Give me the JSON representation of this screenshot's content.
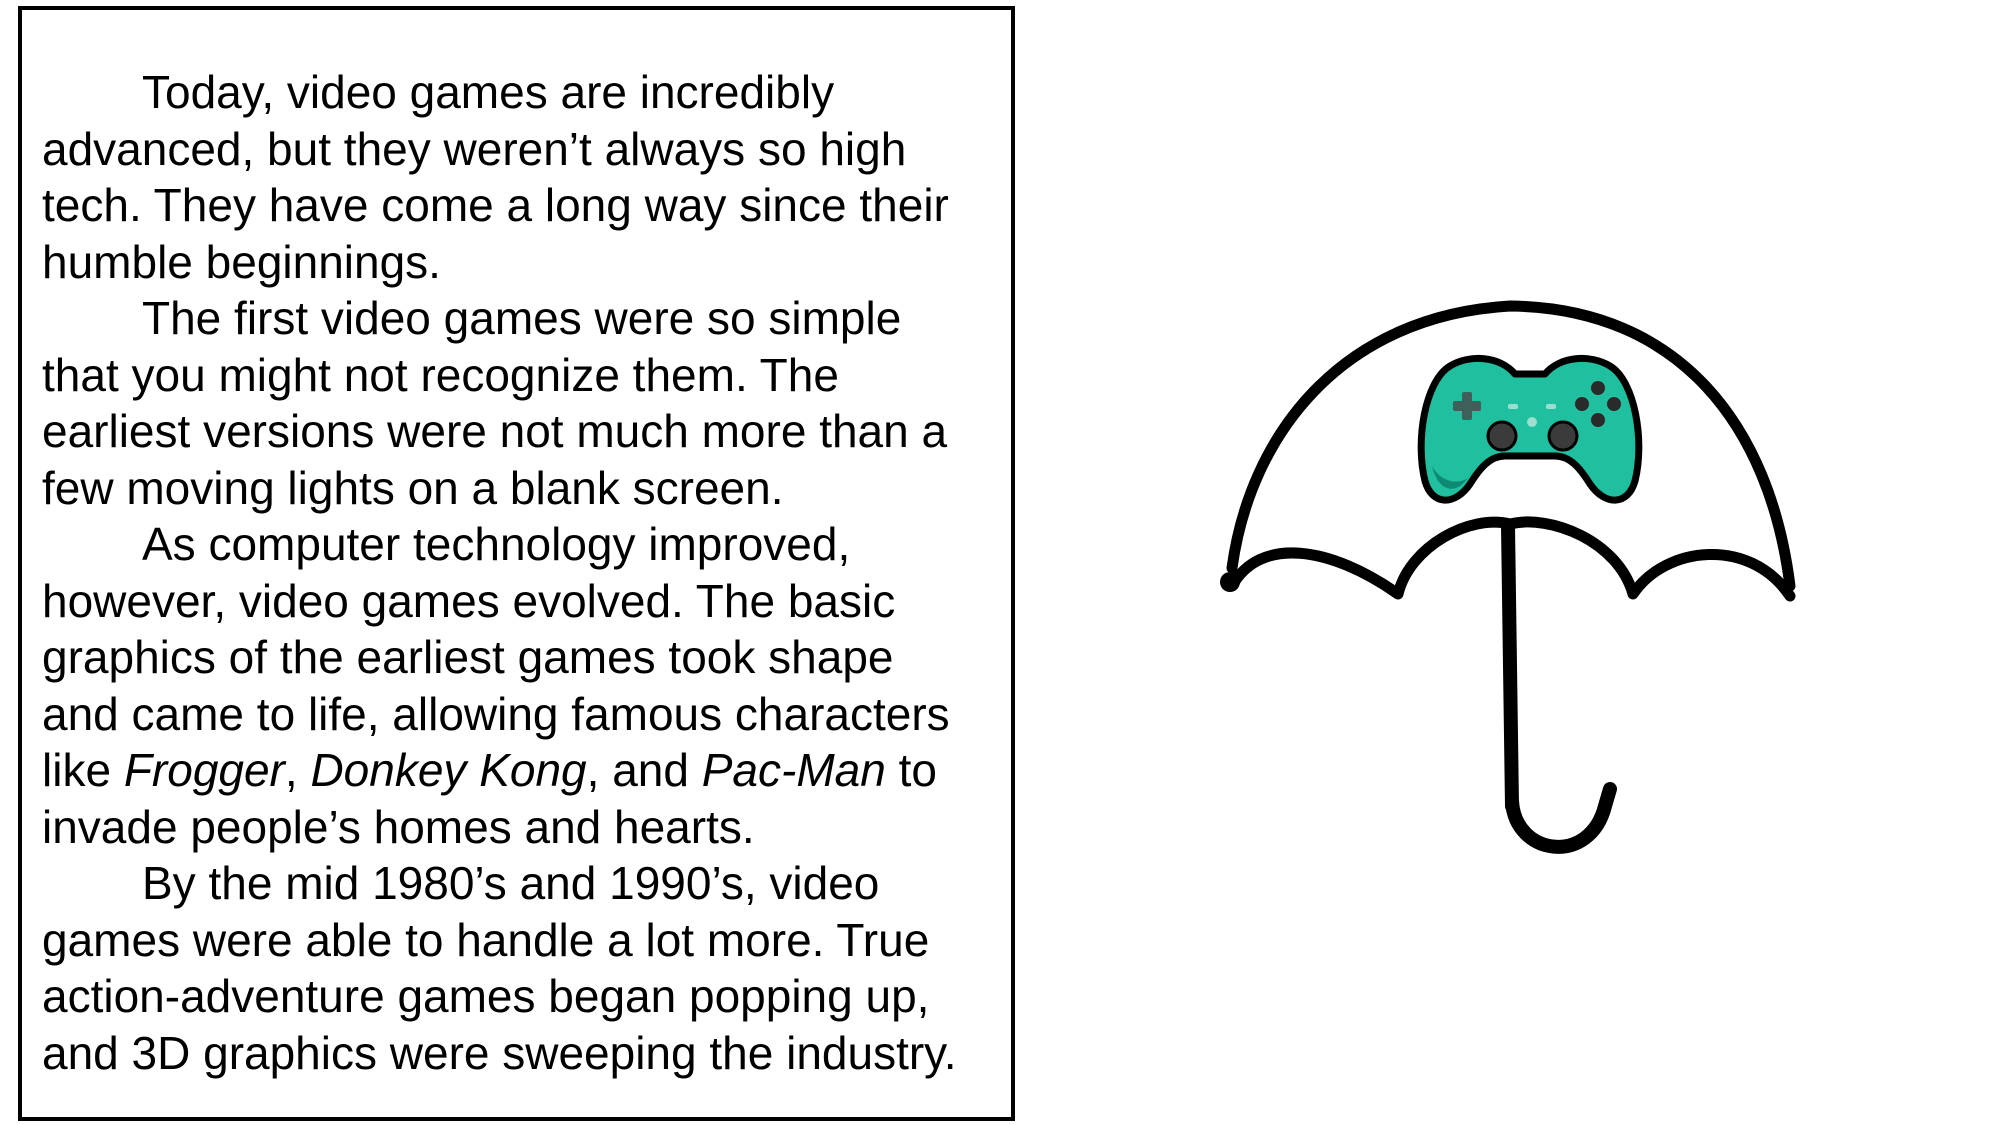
{
  "passage": {
    "paragraphs": [
      {
        "lines": [
          "Today, video games are incredibly",
          "advanced, but they weren’t always so high",
          "tech.  They have come a long way since their",
          "humble beginnings."
        ]
      },
      {
        "lines": [
          "The first video games were so simple",
          "that you might not recognize them.  The",
          "earliest versions were not much more than a",
          "few moving lights on a blank screen."
        ]
      },
      {
        "lines": [
          "As computer technology improved,",
          "however, video games evolved.  The basic",
          "graphics of the earliest games took shape",
          "and came to life, allowing famous characters"
        ],
        "line5": {
          "pre": "like ",
          "frogger": "Frogger",
          "sep1": ", ",
          "donkey_kong": "Donkey Kong",
          "sep2": ", and ",
          "pac_man": "Pac-Man",
          "post": " to"
        },
        "line6": "invade people’s homes and hearts."
      },
      {
        "lines": [
          "By the mid 1980’s and 1990’s, video",
          "games were able to handle a lot more.  True",
          "action-adventure games began popping up,",
          "and 3D graphics were sweeping the industry."
        ]
      }
    ]
  },
  "illustration": {
    "icons": [
      "umbrella-icon",
      "game-controller-icon"
    ],
    "colors": {
      "outline": "#000000",
      "controller_body": "#1fbf9f",
      "controller_shadow": "#0e8a72",
      "background": "#ffffff"
    }
  }
}
